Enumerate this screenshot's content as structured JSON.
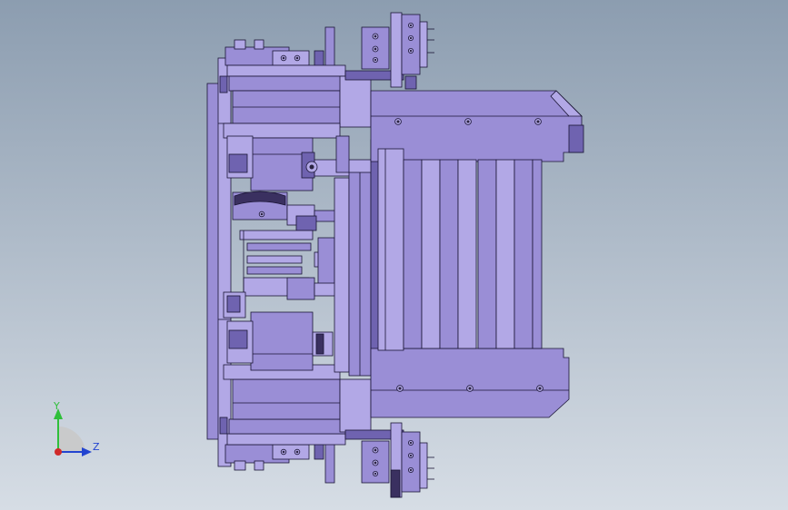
{
  "viewport": {
    "background_top": "#8c9db0",
    "background_bottom": "#d6dde5"
  },
  "colors": {
    "part_fill": "#9a8ed6",
    "part_fill_light": "#b2a8e6",
    "part_fill_dark": "#6f63b0",
    "edge": "#1a1535",
    "hole": "#2a2340",
    "slot_dark": "#3a3060"
  },
  "triad": {
    "y_label": "Y",
    "z_label": "Z",
    "y_color": "#2fbf3a",
    "z_color": "#2244d0",
    "x_color": "#d02a2a",
    "plane_color": "#c9c9c9"
  }
}
